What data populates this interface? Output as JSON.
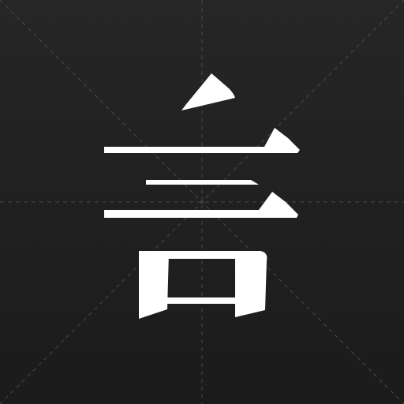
{
  "icon": {
    "character": "言",
    "glyph_color": "#ffffff",
    "background_color": "#222222",
    "grid_color": "#4a4a4a"
  }
}
